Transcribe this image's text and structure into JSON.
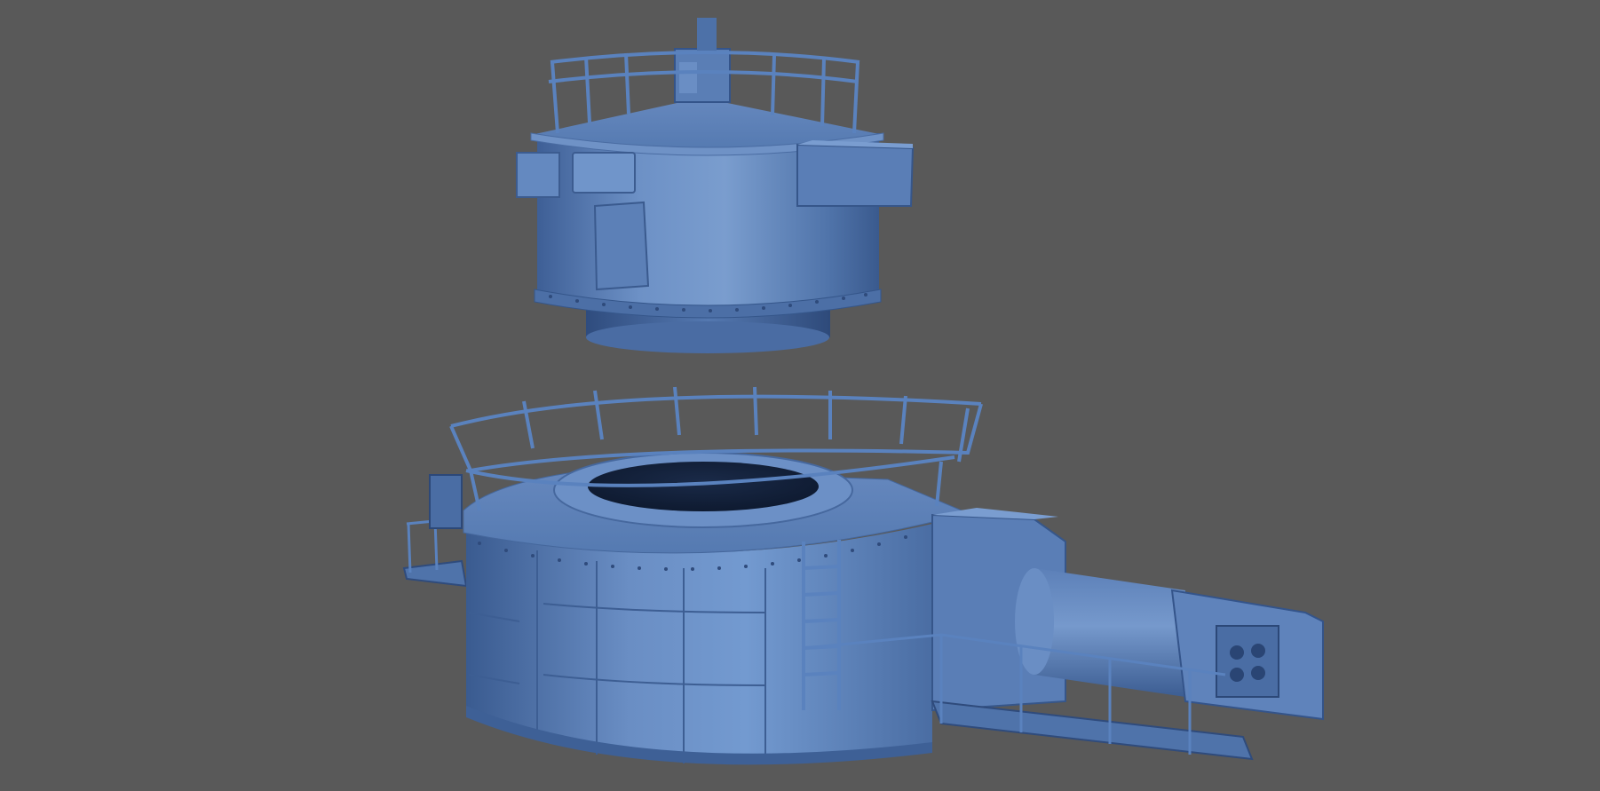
{
  "scene": {
    "subject": "naval-turret-3d-render",
    "parts": [
      "upper-turret-module",
      "lower-barbette-base",
      "gun-barrel-housing",
      "safety-railings",
      "access-ladder",
      "side-walkways"
    ],
    "background_color": "#595959",
    "model_colors": {
      "light": "#7C9DCB",
      "mid": "#5A7FB5",
      "shadow": "#34558A",
      "dark": "#1B2E4E",
      "rail": "#5A82BE"
    }
  }
}
